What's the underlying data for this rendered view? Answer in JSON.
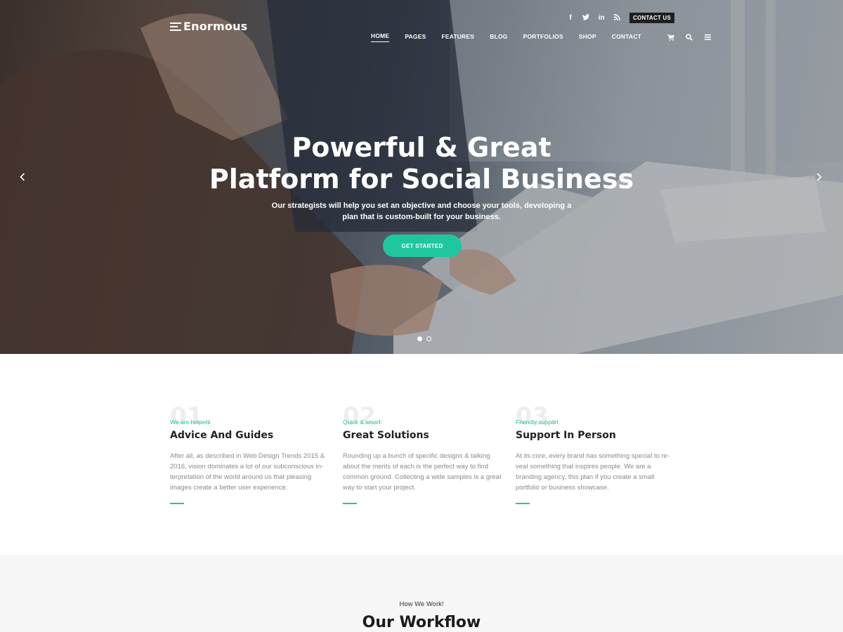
{
  "header": {
    "logo_text": "Enormous",
    "social": [
      {
        "icon": "facebook-icon",
        "glyph": "f"
      },
      {
        "icon": "twitter-icon",
        "glyph": "t"
      },
      {
        "icon": "linkedin-icon",
        "glyph": "in"
      },
      {
        "icon": "rss-icon",
        "glyph": "rss"
      }
    ],
    "contact_button": "CONTACT US",
    "nav": [
      "HOME",
      "PAGES",
      "FEATURES",
      "BLOG",
      "PORTFOLIOS",
      "SHOP",
      "CONTACT"
    ],
    "active_nav": "HOME",
    "nav_icons": [
      "cart-icon",
      "search-icon",
      "menu-icon"
    ]
  },
  "hero": {
    "title_line1": "Powerful & Great",
    "title_line2": "Platform for Social Business",
    "subtitle_line1": "Our strategists will help you set an objective and choose your tools, developing a",
    "subtitle_line2": "plan that is custom-built for your business.",
    "cta": "GET STARTED",
    "slides_total": 2,
    "active_slide": 1,
    "prev_icon": "chevron-left-icon",
    "next_icon": "chevron-right-icon"
  },
  "features": [
    {
      "number": "01.",
      "kicker": "We are helpers",
      "title": "Advice And Guides",
      "text": "After all, as described in Web Design Trends 2015 & 2016, vision dominates a lot of our subconscious in-terpretation of the world around us that pleasing images create a better user experience."
    },
    {
      "number": "02.",
      "kicker": "Quick & smart",
      "title": "Great Solutions",
      "text": "Rounding up a bunch of specific designs & talking about the merits of each is the perfect way to find common ground. Collecting a wide samples is a great way to start your project."
    },
    {
      "number": "03.",
      "kicker": "Friendly support",
      "title": "Support In Person",
      "text": "At its core, every brand has something special to re-veal something that inspires people. We are a branding agency, this plan if you create a small portfolio or business showcase."
    }
  ],
  "workflow": {
    "kicker": "How We Work!",
    "title": "Our Workflow"
  },
  "colors": {
    "accent": "#1ec7a0",
    "dark": "#1f1f1f",
    "muted_text": "#8a8a8a",
    "section_bg": "#f7f7f7"
  }
}
